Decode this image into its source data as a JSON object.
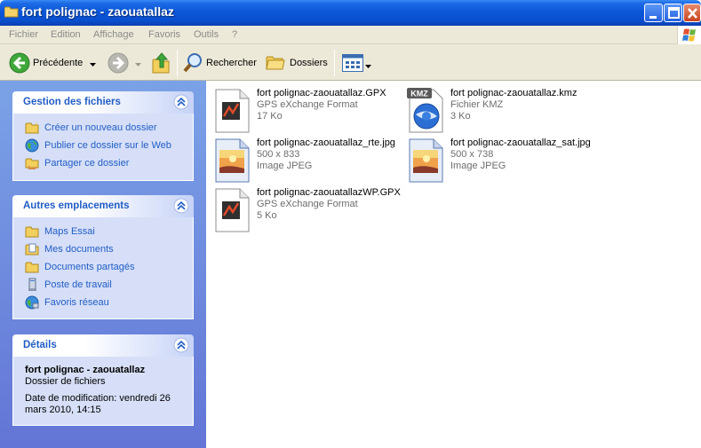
{
  "window": {
    "title": "fort polignac - zaouatallaz"
  },
  "menu": [
    "Fichier",
    "Edition",
    "Affichage",
    "Favoris",
    "Outils",
    "?"
  ],
  "toolbar": {
    "back": "Précédente",
    "search": "Rechercher",
    "folders": "Dossiers"
  },
  "panels": {
    "file_tasks": {
      "title": "Gestion des fichiers",
      "items": [
        "Créer un nouveau dossier",
        "Publier ce dossier sur le Web",
        "Partager ce dossier"
      ]
    },
    "other_places": {
      "title": "Autres emplacements",
      "items": [
        "Maps Essai",
        "Mes documents",
        "Documents partagés",
        "Poste de travail",
        "Favoris réseau"
      ]
    },
    "details": {
      "title": "Détails",
      "name": "fort polignac - zaouatallaz",
      "type": "Dossier de fichiers",
      "modified_line1": "Date de modification: vendredi 26",
      "modified_line2": "mars 2010, 14:15"
    }
  },
  "files": [
    {
      "name": "fort polignac-zaouatallaz.GPX",
      "line2": "GPS eXchange Format",
      "line3": "17 Ko",
      "icon": "gpx-file-icon"
    },
    {
      "name": "fort polignac-zaouatallaz.kmz",
      "line2": "Fichier KMZ",
      "line3": "3 Ko",
      "icon": "kmz-file-icon"
    },
    {
      "name": "fort polignac-zaouatallaz_rte.jpg",
      "line2": "500 x 833",
      "line3": "Image JPEG",
      "icon": "jpeg-file-icon"
    },
    {
      "name": "fort polignac-zaouatallaz_sat.jpg",
      "line2": "500 x 738",
      "line3": "Image JPEG",
      "icon": "jpeg-file-icon"
    },
    {
      "name": "fort polignac-zaouatallazWP.GPX",
      "line2": "GPS eXchange Format",
      "line3": "5 Ko",
      "icon": "gpx-file-icon"
    }
  ]
}
